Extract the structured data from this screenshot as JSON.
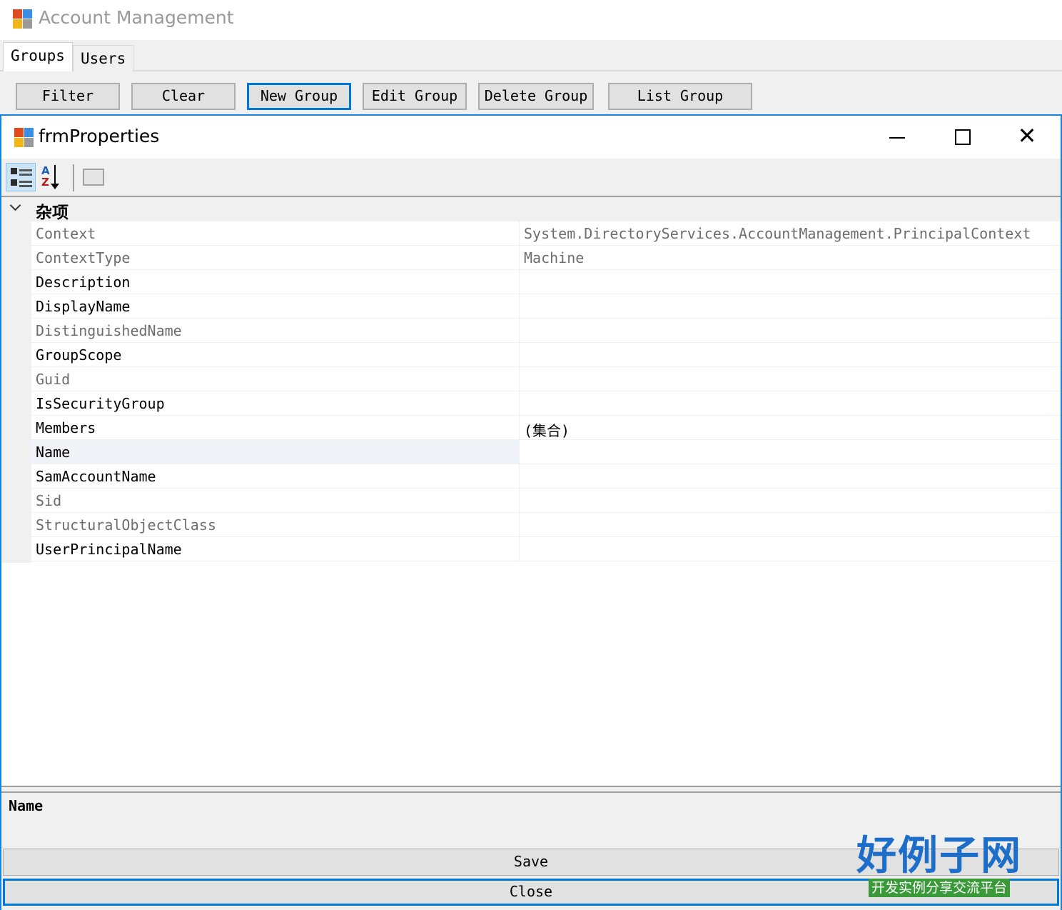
{
  "outer_window": {
    "title": "Account Management",
    "tabs": [
      {
        "label": "Groups",
        "active": true
      },
      {
        "label": "Users",
        "active": false
      }
    ],
    "buttons": [
      {
        "label": "Filter"
      },
      {
        "label": "Clear"
      },
      {
        "label": "New Group",
        "focused": true
      },
      {
        "label": "Edit Group"
      },
      {
        "label": "Delete Group"
      },
      {
        "label": "List Group"
      }
    ]
  },
  "inner_window": {
    "title": "frmProperties",
    "controls": {
      "close_glyph": "✕"
    },
    "toolbar_icons": [
      "categorized-icon",
      "alphabetical-sort-icon",
      "property-pages-icon"
    ],
    "category": "杂项",
    "properties": [
      {
        "name": "Context",
        "value": "System.DirectoryServices.AccountManagement.PrincipalContext",
        "readonly": true
      },
      {
        "name": "ContextType",
        "value": "Machine",
        "readonly": true
      },
      {
        "name": "Description",
        "value": "",
        "readonly": false
      },
      {
        "name": "DisplayName",
        "value": "",
        "readonly": false
      },
      {
        "name": "DistinguishedName",
        "value": "",
        "readonly": true
      },
      {
        "name": "GroupScope",
        "value": "",
        "readonly": false
      },
      {
        "name": "Guid",
        "value": "",
        "readonly": true
      },
      {
        "name": "IsSecurityGroup",
        "value": "",
        "readonly": false
      },
      {
        "name": "Members",
        "value": "(集合)",
        "readonly": false
      },
      {
        "name": "Name",
        "value": "",
        "readonly": false,
        "selected": true
      },
      {
        "name": "SamAccountName",
        "value": "",
        "readonly": false
      },
      {
        "name": "Sid",
        "value": "",
        "readonly": true
      },
      {
        "name": "StructuralObjectClass",
        "value": "",
        "readonly": true
      },
      {
        "name": "UserPrincipalName",
        "value": "",
        "readonly": false
      }
    ],
    "description_title": "Name",
    "save_label": "Save",
    "close_label": "Close"
  },
  "watermark": {
    "logo_big": "好例子网",
    "logo_small": "开发实例分享交流平台"
  },
  "colors": {
    "focus_blue": "#0078d7",
    "readonly_text": "#6d6d6d",
    "logo_blue": "#1c6ec9",
    "logo_green": "#3a9a3a"
  }
}
